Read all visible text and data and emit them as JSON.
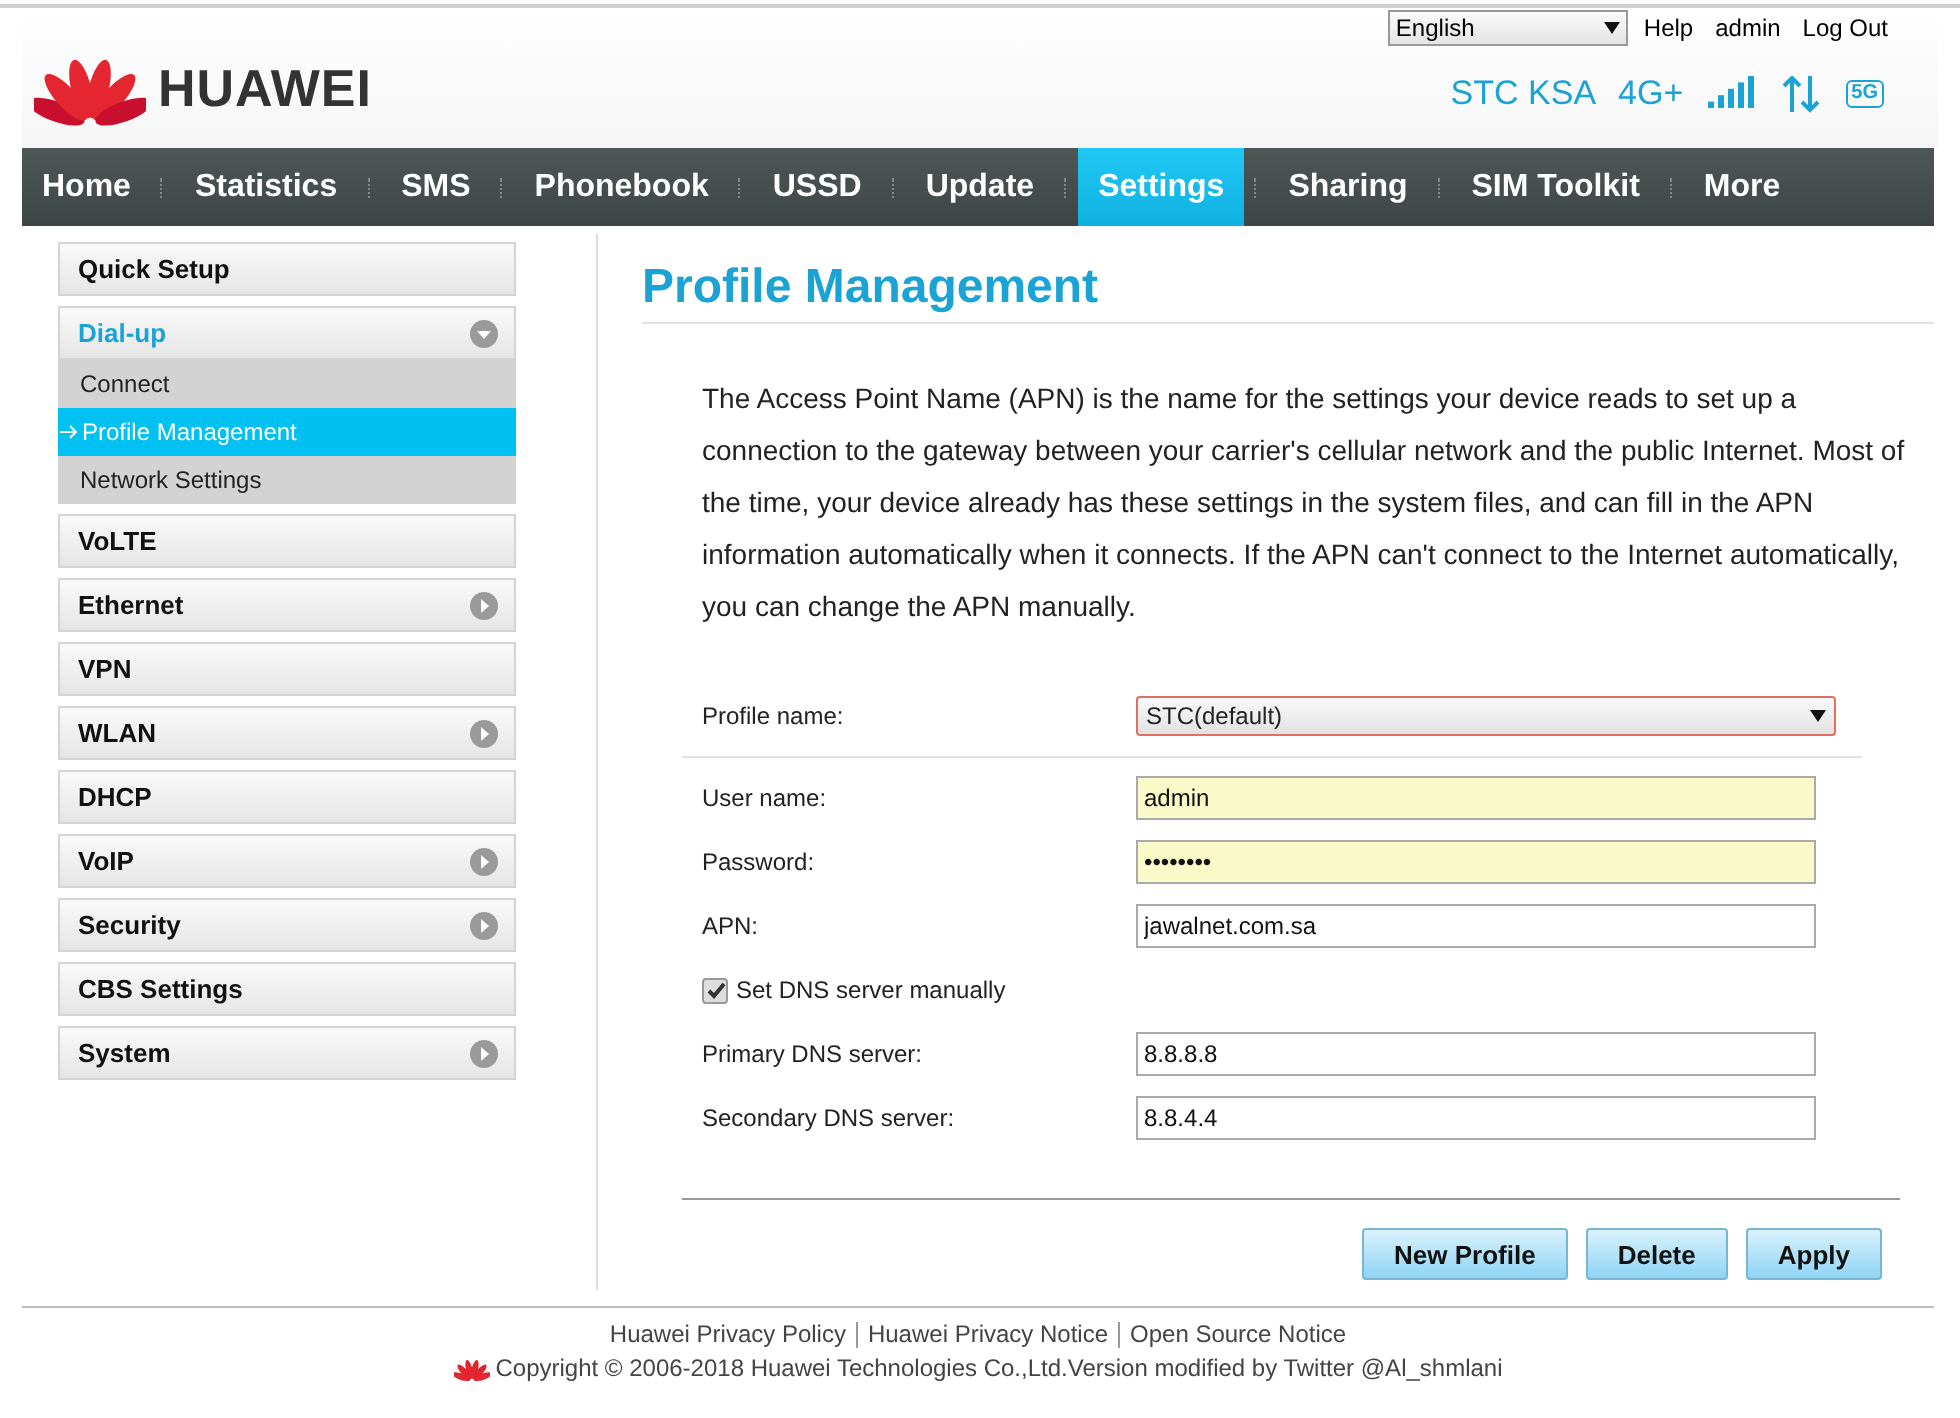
{
  "header": {
    "brand": "HUAWEI",
    "language": "English",
    "links": [
      "Help",
      "admin",
      "Log Out"
    ],
    "carrier": "STC KSA",
    "network": "4G+",
    "badge": "5G"
  },
  "nav": [
    {
      "label": "Home",
      "selected": false
    },
    {
      "label": "Statistics",
      "selected": false
    },
    {
      "label": "SMS",
      "selected": false
    },
    {
      "label": "Phonebook",
      "selected": false
    },
    {
      "label": "USSD",
      "selected": false
    },
    {
      "label": "Update",
      "selected": false
    },
    {
      "label": "Settings",
      "selected": true
    },
    {
      "label": "Sharing",
      "selected": false
    },
    {
      "label": "SIM Toolkit",
      "selected": false
    },
    {
      "label": "More",
      "selected": false
    }
  ],
  "sidebar": [
    {
      "label": "Quick Setup",
      "kind": "plain",
      "selected": false
    },
    {
      "label": "Dial-up",
      "kind": "expandable",
      "expanded": true,
      "selected": true,
      "children": [
        {
          "label": "Connect",
          "selected": false
        },
        {
          "label": "Profile Management",
          "selected": true
        },
        {
          "label": "Network Settings",
          "selected": false
        }
      ]
    },
    {
      "label": "VoLTE",
      "kind": "plain",
      "selected": false
    },
    {
      "label": "Ethernet",
      "kind": "expandable",
      "expanded": false,
      "selected": false
    },
    {
      "label": "VPN",
      "kind": "plain",
      "selected": false
    },
    {
      "label": "WLAN",
      "kind": "expandable",
      "expanded": false,
      "selected": false
    },
    {
      "label": "DHCP",
      "kind": "plain",
      "selected": false
    },
    {
      "label": "VoIP",
      "kind": "expandable",
      "expanded": false,
      "selected": false
    },
    {
      "label": "Security",
      "kind": "expandable",
      "expanded": false,
      "selected": false
    },
    {
      "label": "CBS Settings",
      "kind": "plain",
      "selected": false
    },
    {
      "label": "System",
      "kind": "expandable",
      "expanded": false,
      "selected": false
    }
  ],
  "page": {
    "title": "Profile Management",
    "description": "The Access Point Name (APN) is the name for the settings your device reads to set up a connection to the gateway between your carrier's cellular network and the public Internet. Most of the time, your device already has these settings in the system files, and can fill in the APN information automatically when it connects. If the APN can't connect to the Internet automatically, you can change the APN manually."
  },
  "form": [
    {
      "kind": "select",
      "label": "Profile name:",
      "value": "STC(default)"
    },
    {
      "kind": "divider"
    },
    {
      "kind": "text",
      "label": "User name:",
      "value": "admin",
      "autofilled": true
    },
    {
      "kind": "text",
      "label": "Password:",
      "value": "••••••••",
      "autofilled": true
    },
    {
      "kind": "text",
      "label": "APN:",
      "value": "jawalnet.com.sa",
      "autofilled": false
    },
    {
      "kind": "checkbox",
      "label": "Set DNS server manually",
      "checked": true
    },
    {
      "kind": "text",
      "label": "Primary DNS server:",
      "value": "8.8.8.8",
      "autofilled": false
    },
    {
      "kind": "text",
      "label": "Secondary DNS server:",
      "value": "8.8.4.4",
      "autofilled": false
    }
  ],
  "buttons": [
    "New Profile",
    "Delete",
    "Apply"
  ],
  "footer": {
    "links": [
      "Huawei Privacy Policy",
      "Huawei Privacy Notice",
      "Open Source Notice"
    ],
    "copyright": "Copyright © 2006-2018 Huawei Technologies Co.,Ltd.Version modified by Twitter @Al_shmlani"
  }
}
